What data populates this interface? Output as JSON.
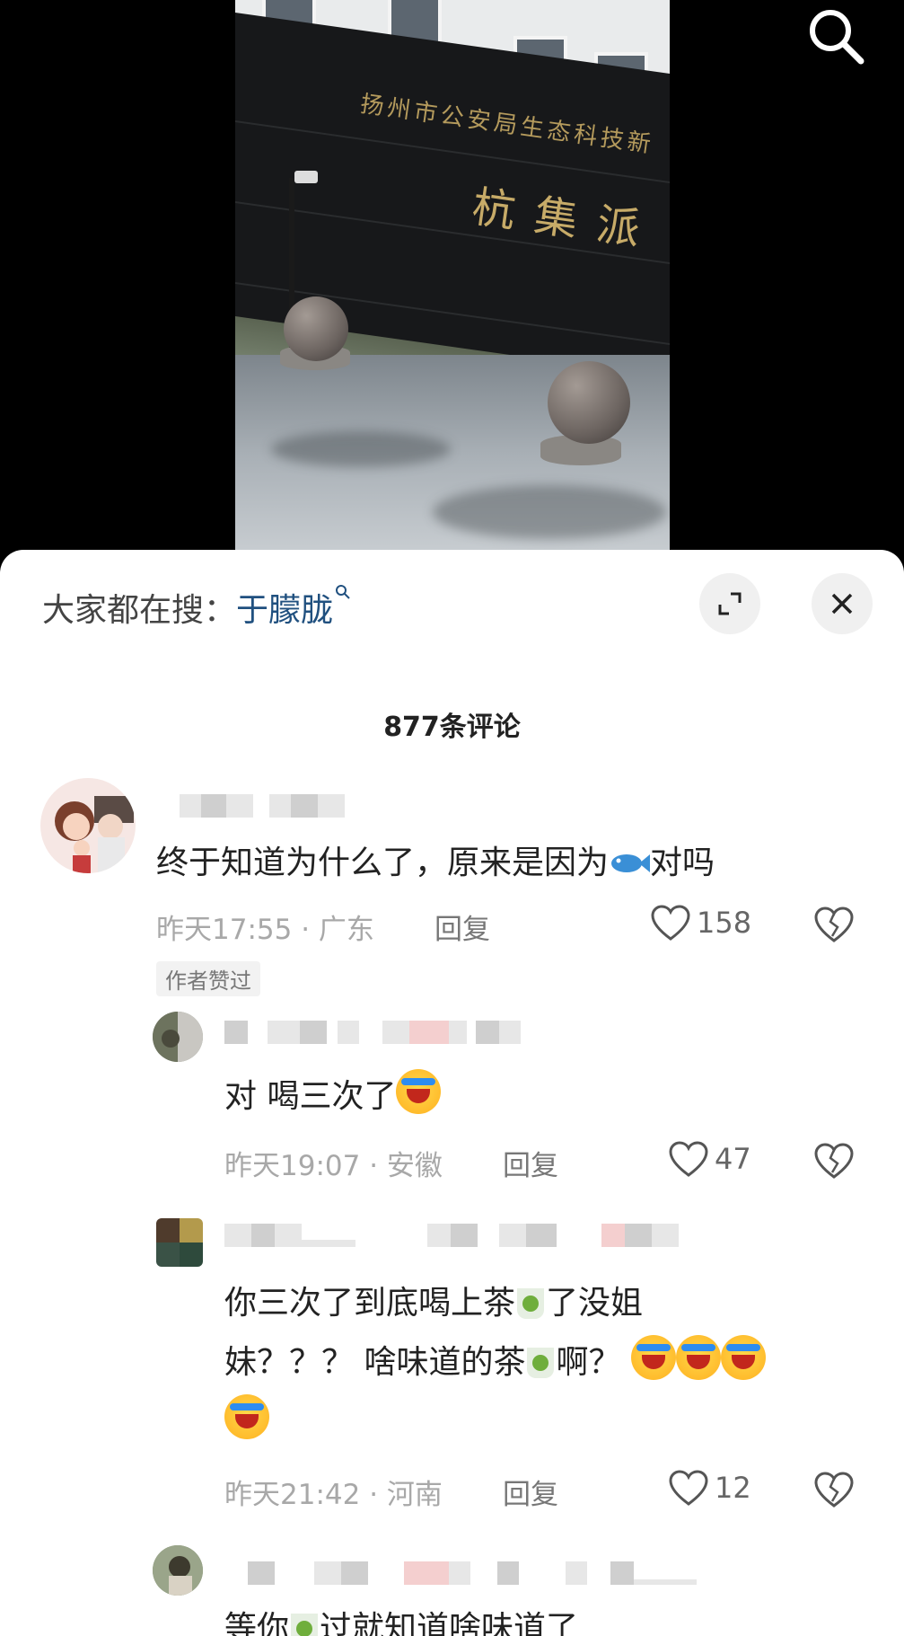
{
  "video": {
    "sign_line1": "扬州市公安局生态科技新",
    "sign_line2": "杭集派",
    "search_icon": "search-icon"
  },
  "sheet": {
    "trending_prefix": "大家都在搜：",
    "trending_keyword": "于朦胧",
    "expand_icon": "expand-icon",
    "close_icon": "close-icon",
    "comment_count": "877条评论"
  },
  "comments": [
    {
      "text_before": "终于知道为什么了，原来是因为",
      "emoji": "fish-icon",
      "text_after": "对吗",
      "time_loc": "昨天17:55 · 广东",
      "reply": "回复",
      "likes": "158",
      "badge": "作者赞过"
    },
    {
      "text": "对 喝三次了",
      "time_loc": "昨天19:07 · 安徽",
      "reply": "回复",
      "likes": "47"
    },
    {
      "text_a": "你三次了到底喝上茶",
      "text_b": "了没姐",
      "text_c": "妹？？？ 啥味道的茶",
      "text_d": "啊？",
      "time_loc": "昨天21:42 · 河南",
      "reply": "回复",
      "likes": "12"
    },
    {
      "text_a": "等你",
      "text_b": "过就知道啥味道了"
    }
  ]
}
